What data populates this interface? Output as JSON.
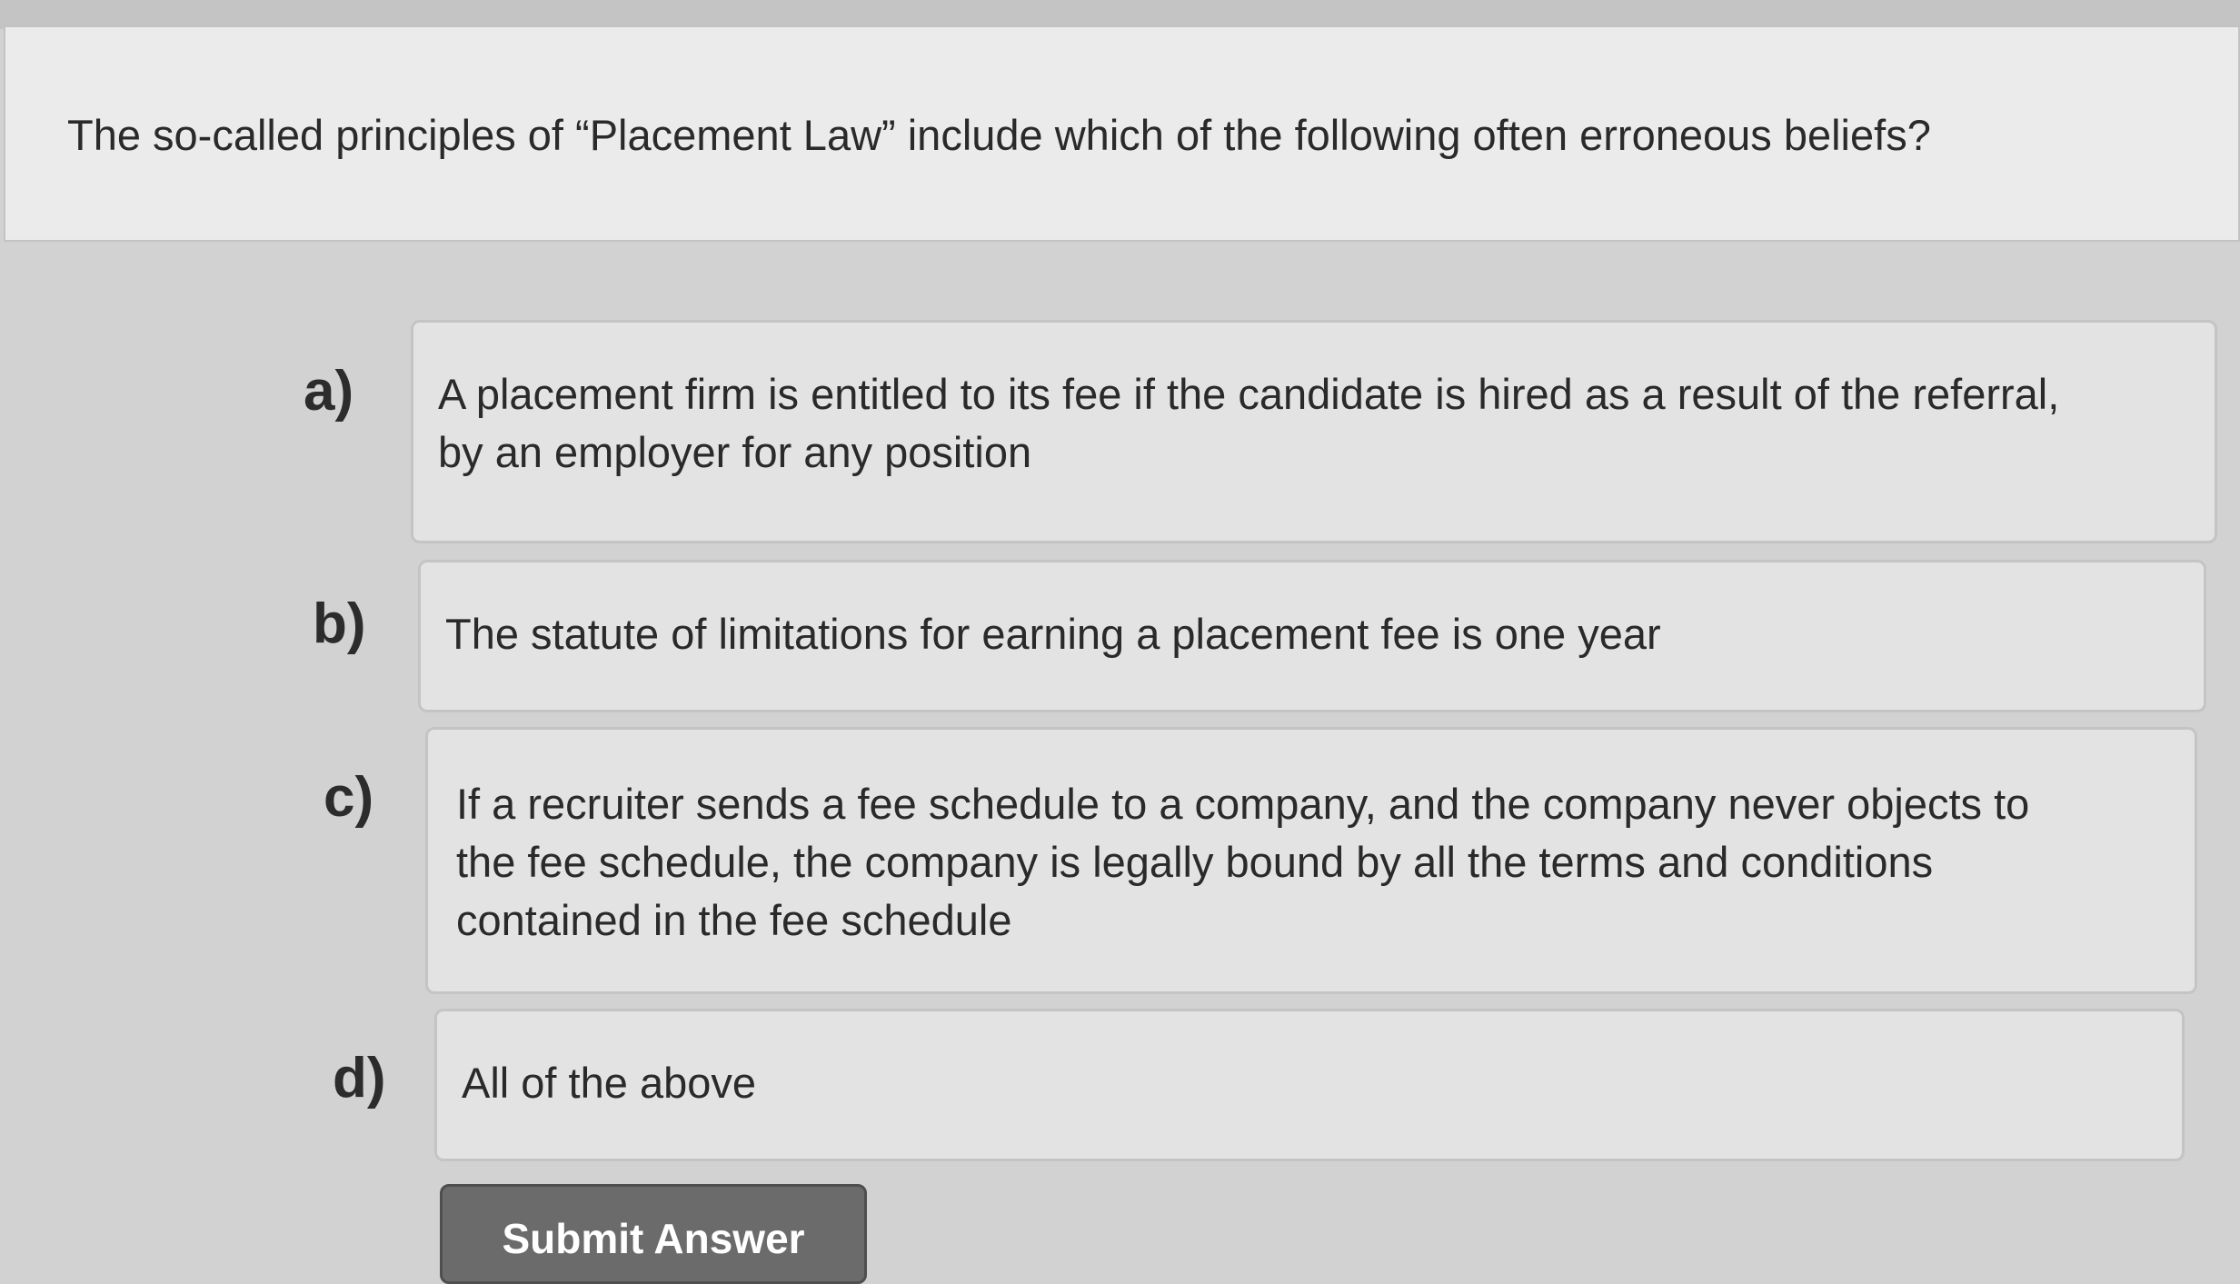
{
  "question": {
    "text": "The so-called principles of “Placement Law” include which of the following often erroneous beliefs?"
  },
  "options": [
    {
      "letter": "a)",
      "lines": [
        "A placement firm is entitled to its fee if the candidate is hired as a result of the referral,",
        "by an employer for any position"
      ]
    },
    {
      "letter": "b)",
      "lines": [
        "The statute of limitations for earning a placement fee is one year"
      ]
    },
    {
      "letter": "c)",
      "lines": [
        "If a recruiter sends a fee schedule to a company, and the company never objects to",
        "the fee schedule, the company is legally bound by all the terms and conditions",
        "contained in the fee schedule"
      ]
    },
    {
      "letter": "d)",
      "lines": [
        "All of the above"
      ]
    }
  ],
  "submit": {
    "label": "Submit Answer"
  }
}
